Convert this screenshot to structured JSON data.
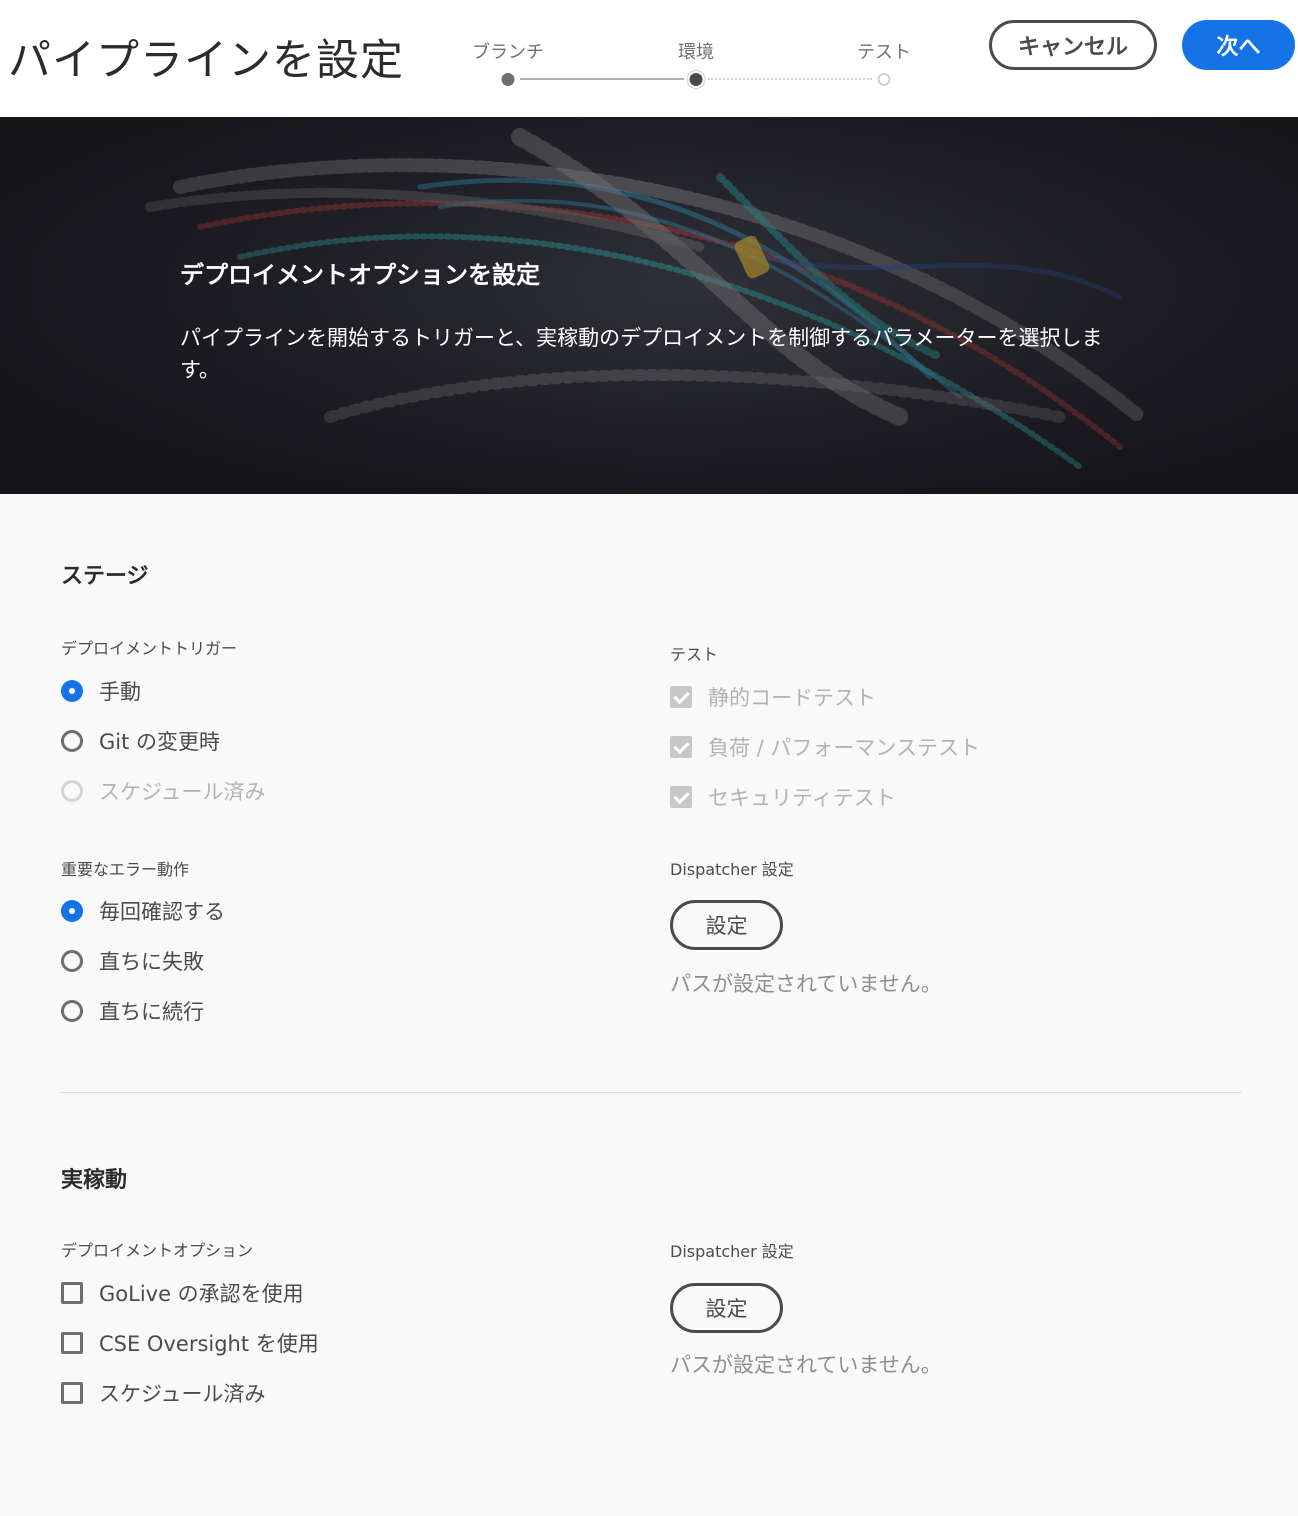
{
  "header": {
    "title": "パイプラインを設定",
    "steps": [
      {
        "label": "ブランチ",
        "state": "done"
      },
      {
        "label": "環境",
        "state": "current"
      },
      {
        "label": "テスト",
        "state": "pending"
      }
    ],
    "cancel_label": "キャンセル",
    "next_label": "次へ"
  },
  "hero": {
    "title": "デプロイメントオプションを設定",
    "description": "パイプラインを開始するトリガーと、実稼動のデプロイメントを制御するパラメーターを選択します。"
  },
  "stage": {
    "title": "ステージ",
    "trigger": {
      "label": "デプロイメントトリガー",
      "options": [
        {
          "label": "手動",
          "checked": true,
          "disabled": false
        },
        {
          "label": "Git の変更時",
          "checked": false,
          "disabled": false
        },
        {
          "label": "スケジュール済み",
          "checked": false,
          "disabled": true
        }
      ]
    },
    "error_behavior": {
      "label": "重要なエラー動作",
      "options": [
        {
          "label": "毎回確認する",
          "checked": true
        },
        {
          "label": "直ちに失敗",
          "checked": false
        },
        {
          "label": "直ちに続行",
          "checked": false
        }
      ]
    },
    "tests": {
      "label": "テスト",
      "options": [
        {
          "label": "静的コードテスト",
          "checked": true,
          "disabled": true
        },
        {
          "label": "負荷 / パフォーマンステスト",
          "checked": true,
          "disabled": true
        },
        {
          "label": "セキュリティテスト",
          "checked": true,
          "disabled": true
        }
      ]
    },
    "dispatcher": {
      "label": "Dispatcher 設定",
      "button_label": "設定",
      "note": "パスが設定されていません。"
    }
  },
  "production": {
    "title": "実稼動",
    "deploy_options": {
      "label": "デプロイメントオプション",
      "options": [
        {
          "label": "GoLive の承認を使用",
          "checked": false
        },
        {
          "label": "CSE Oversight を使用",
          "checked": false
        },
        {
          "label": "スケジュール済み",
          "checked": false
        }
      ]
    },
    "dispatcher": {
      "label": "Dispatcher 設定",
      "button_label": "設定",
      "note": "パスが設定されていません。"
    }
  },
  "colors": {
    "accent": "#1473e6",
    "hero_bg": "#1e1e24",
    "page_bg": "#f9f9f9"
  }
}
